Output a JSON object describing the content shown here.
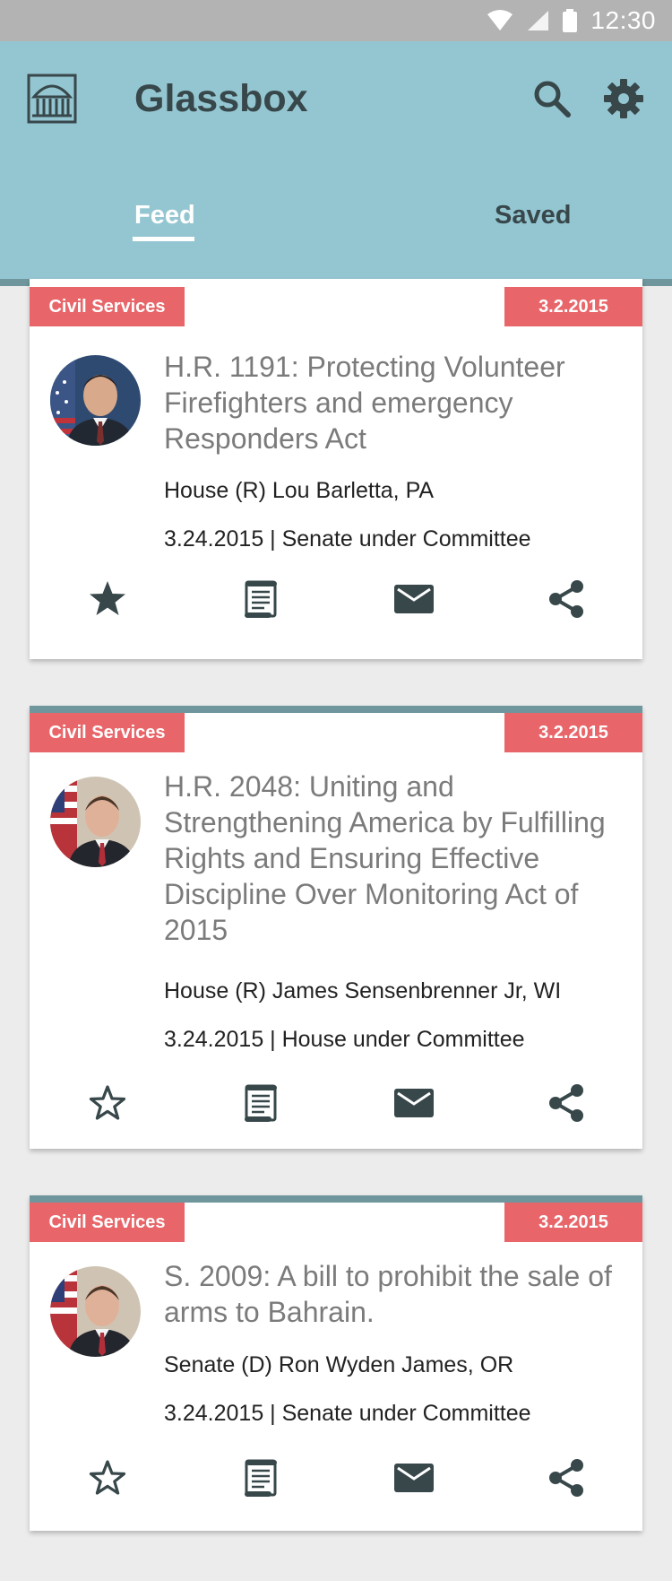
{
  "status_bar": {
    "time": "12:30"
  },
  "app": {
    "title": "Glassbox",
    "icons": {
      "logo": "capitol-icon",
      "search": "search-icon",
      "settings": "gear-icon"
    },
    "tabs": [
      {
        "label": "Feed",
        "active": true
      },
      {
        "label": "Saved",
        "active": false
      }
    ]
  },
  "colors": {
    "appbar": "#94c6d2",
    "accent": "#e8666a",
    "divider": "#6e969c"
  },
  "bills": [
    {
      "category": "Civil Services",
      "date": "3.2.2015",
      "title": "H.R. 1191: Protecting Volunteer Firefighters and emergency Responders Act",
      "sponsor": "House (R) Lou Barletta, PA",
      "status": "3.24.2015 | Senate under Committee",
      "starred": true
    },
    {
      "category": "Civil Services",
      "date": "3.2.2015",
      "title": "H.R. 2048: Uniting and Strengthening America by Fulfilling Rights and Ensuring Effective Discipline Over Monitoring Act of 2015",
      "sponsor": "House (R) James Sensenbrenner Jr, WI",
      "status": "3.24.2015 | House under Committee",
      "starred": false
    },
    {
      "category": "Civil Services",
      "date": "3.2.2015",
      "title": "S. 2009: A bill to prohibit the sale of arms to Bahrain.",
      "sponsor": "Senate (D) Ron Wyden James, OR",
      "status": "3.24.2015 | Senate under Committee",
      "starred": false
    }
  ]
}
